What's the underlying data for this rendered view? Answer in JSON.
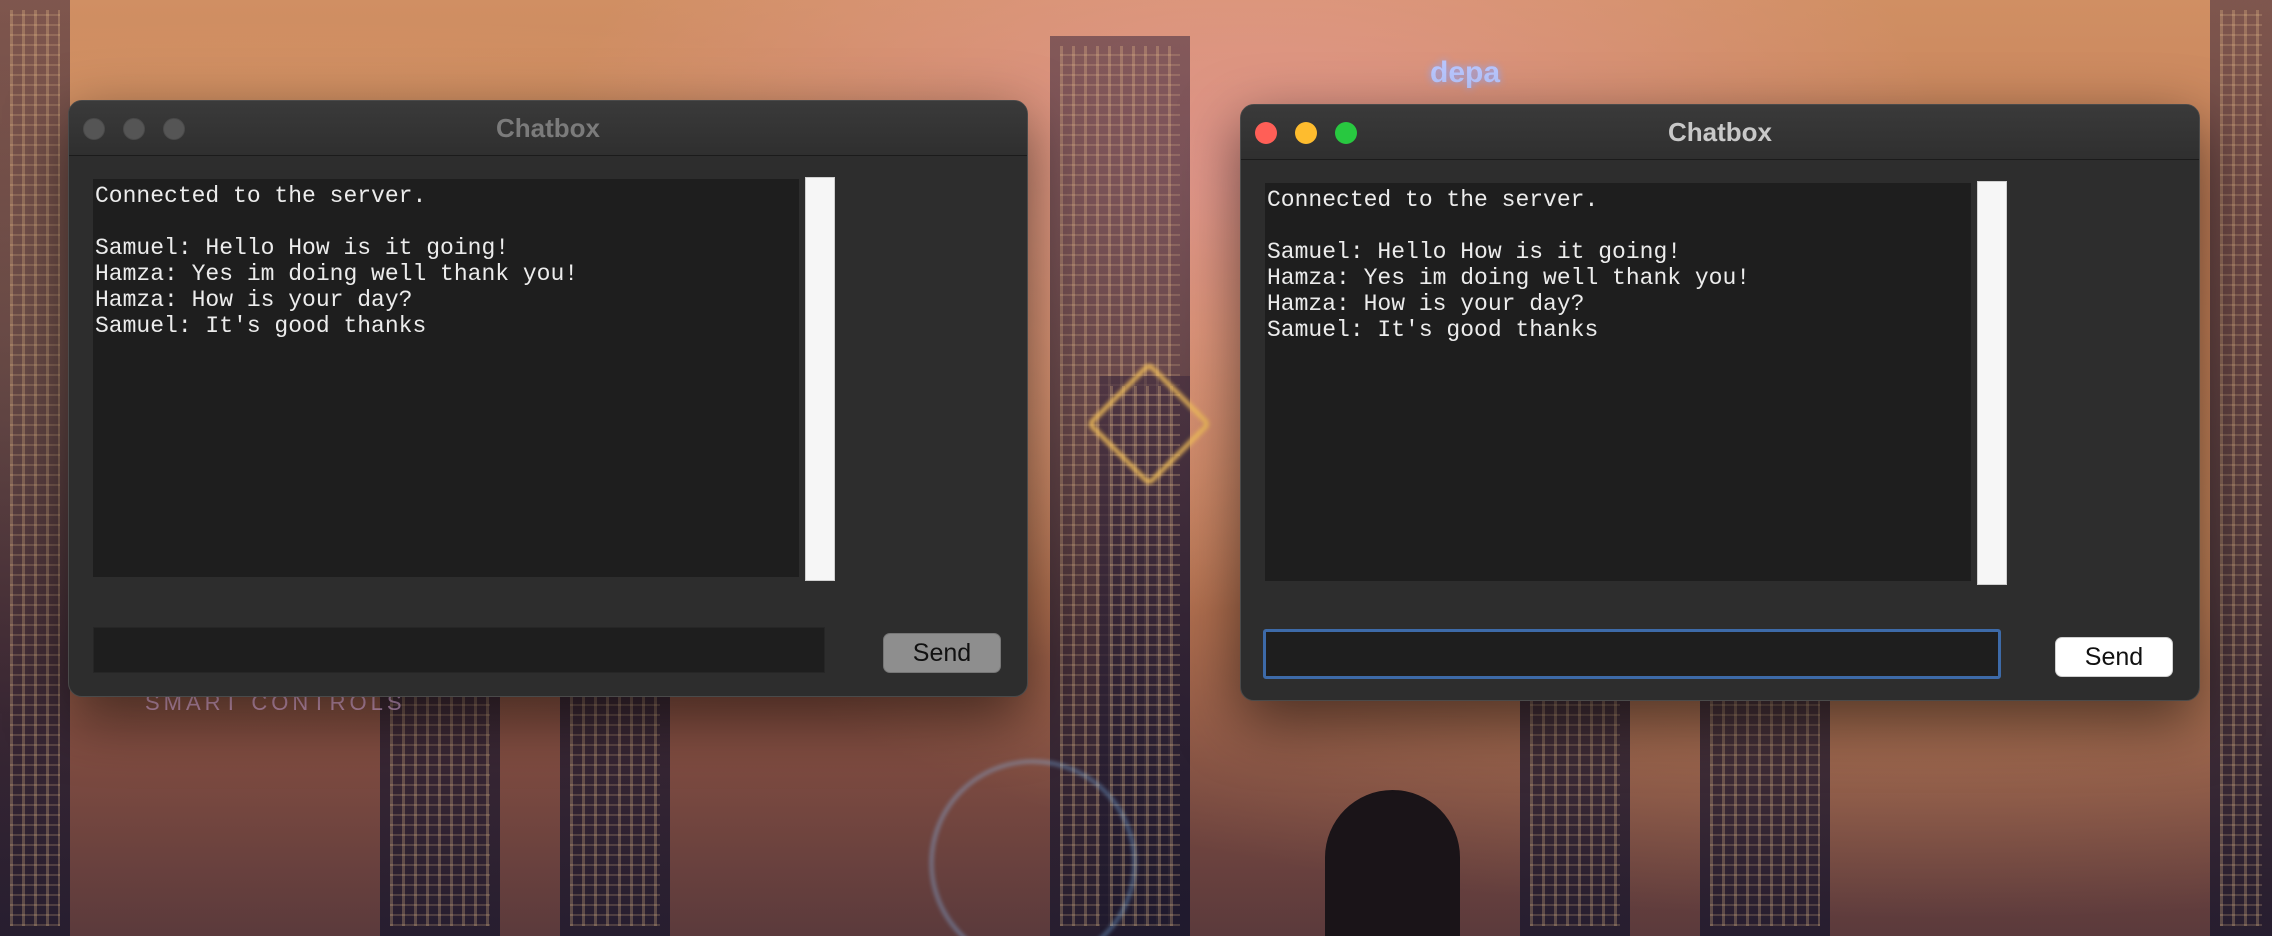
{
  "wallpaper": {
    "sign": "depa",
    "banner": "SMART CONTROLS"
  },
  "windows": [
    {
      "title": "Chatbox",
      "state": "inactive",
      "chat_lines": [
        "Connected to the server.",
        "",
        "Samuel: Hello How is it going!",
        "Hamza: Yes im doing well thank you!",
        "Hamza: How is your day?",
        "Samuel: It's good thanks"
      ],
      "input_value": "",
      "send_label": "Send"
    },
    {
      "title": "Chatbox",
      "state": "active",
      "chat_lines": [
        "Connected to the server.",
        "",
        "Samuel: Hello How is it going!",
        "Hamza: Yes im doing well thank you!",
        "Hamza: How is your day?",
        "Samuel: It's good thanks"
      ],
      "input_value": "",
      "send_label": "Send"
    }
  ],
  "colors": {
    "close": "#ff5f57",
    "minimize": "#febc2e",
    "maximize": "#28c840",
    "focus_ring": "#3d6aa8"
  }
}
